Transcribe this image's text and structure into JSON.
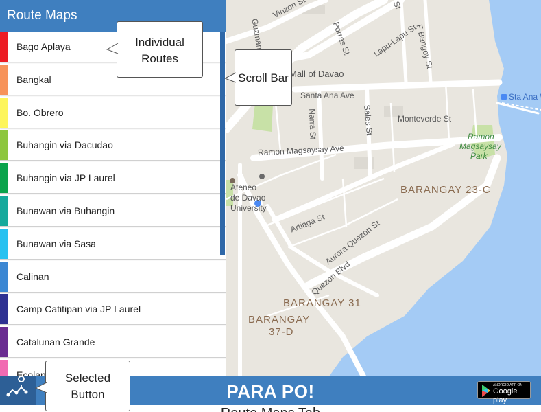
{
  "panel": {
    "title": "Route Maps",
    "routes": [
      {
        "label": "Bago Aplaya",
        "color": "#ec1c24"
      },
      {
        "label": "Bangkal",
        "color": "#f7935a"
      },
      {
        "label": "Bo. Obrero",
        "color": "#fdf55c"
      },
      {
        "label": "Buhangin via Dacudao",
        "color": "#8dc63f"
      },
      {
        "label": "Buhangin via JP Laurel",
        "color": "#0aa34b"
      },
      {
        "label": "Bunawan via Buhangin",
        "color": "#16a99c"
      },
      {
        "label": "Bunawan via Sasa",
        "color": "#27c1f0"
      },
      {
        "label": "Calinan",
        "color": "#3b87d3"
      },
      {
        "label": "Camp Catitipan via JP Laurel",
        "color": "#2e3192"
      },
      {
        "label": "Catalunan Grande",
        "color": "#6a2c91"
      },
      {
        "label": "Ecoland",
        "color": "#f16bb2"
      }
    ]
  },
  "map": {
    "streets": {
      "vinzon": "Vinzon St",
      "guzman": "Guzman St",
      "porras": "Porras St",
      "lapulapu": "Lapu-Lapu St",
      "fbangoy": "F Bangoy St",
      "s_top": "St",
      "mall": "Mall of Davao",
      "santa_ana": "Santa Ana Ave",
      "narra": "Narra St",
      "sales": "Sales St",
      "monteverde": "Monteverde St",
      "magsaysay": "Ramon Magsaysay Ave",
      "artiaga": "Artiaga St",
      "aurora": "Aurora Quezon St",
      "quezon": "Quezon Blvd",
      "sta_ana_pier": "Sta Ana W"
    },
    "poi": {
      "ateneo": [
        "Ateneo",
        "de Davao",
        "University"
      ],
      "park": [
        "Ramon",
        "Magsaysay",
        "Park"
      ]
    },
    "districts": {
      "b23c": "BARANGAY 23-C",
      "b31": "BARANGAY 31",
      "b37d": [
        "BARANGAY",
        "37-D"
      ]
    }
  },
  "bottom_bar": {
    "title": "PARA PO!",
    "play_small": "ANDROID APP ON",
    "play_big": "Google play"
  },
  "callouts": {
    "individual_routes": [
      "Individual",
      "Routes"
    ],
    "scroll_bar": "Scroll Bar",
    "selected_button": [
      "Selected",
      "Button"
    ]
  },
  "footer": {
    "caption": "Route Maps Tab"
  },
  "colors": {
    "header_blue": "#3f7fbf",
    "scrollbar": "#2f68a8",
    "water": "#a4cbf5",
    "land": "#e9e6df",
    "park_green": "#c8e1a7"
  }
}
